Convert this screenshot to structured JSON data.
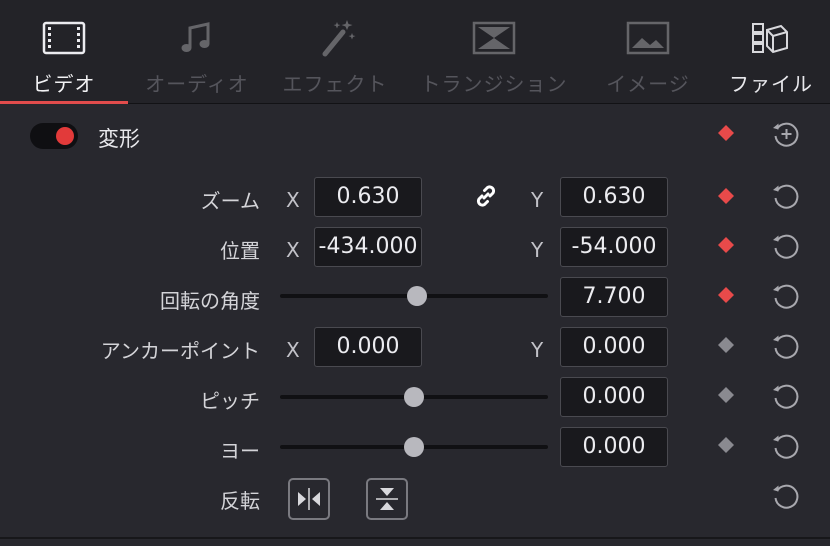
{
  "tabs": [
    {
      "label": "ビデオ",
      "icon": "film-strip-icon",
      "active": true
    },
    {
      "label": "オーディオ",
      "icon": "music-note-icon",
      "active": false
    },
    {
      "label": "エフェクト",
      "icon": "magic-wand-icon",
      "active": false
    },
    {
      "label": "トランジション",
      "icon": "transition-icon",
      "active": false
    },
    {
      "label": "イメージ",
      "icon": "image-icon",
      "active": false
    },
    {
      "label": "ファイル",
      "icon": "file-camera-icon",
      "active": false
    }
  ],
  "section": {
    "title": "変形",
    "enabled": true
  },
  "rows": {
    "zoom": {
      "label": "ズーム",
      "x_axis": "X",
      "x": "0.630",
      "y_axis": "Y",
      "y": "0.630",
      "linked": true
    },
    "position": {
      "label": "位置",
      "x_axis": "X",
      "x": "-434.000",
      "y_axis": "Y",
      "y": "-54.000"
    },
    "rotation": {
      "label": "回転の角度",
      "value": "7.700",
      "slider_fraction": 0.51
    },
    "anchor": {
      "label": "アンカーポイント",
      "x_axis": "X",
      "x": "0.000",
      "y_axis": "Y",
      "y": "0.000"
    },
    "pitch": {
      "label": "ピッチ",
      "value": "0.000",
      "slider_fraction": 0.5
    },
    "yaw": {
      "label": "ヨー",
      "value": "0.000",
      "slider_fraction": 0.5
    },
    "flip": {
      "label": "反転"
    }
  },
  "colors": {
    "accent": "#e24c4c",
    "keyframe_active": "#e84a4a",
    "keyframe_inactive": "#8a8a90"
  }
}
